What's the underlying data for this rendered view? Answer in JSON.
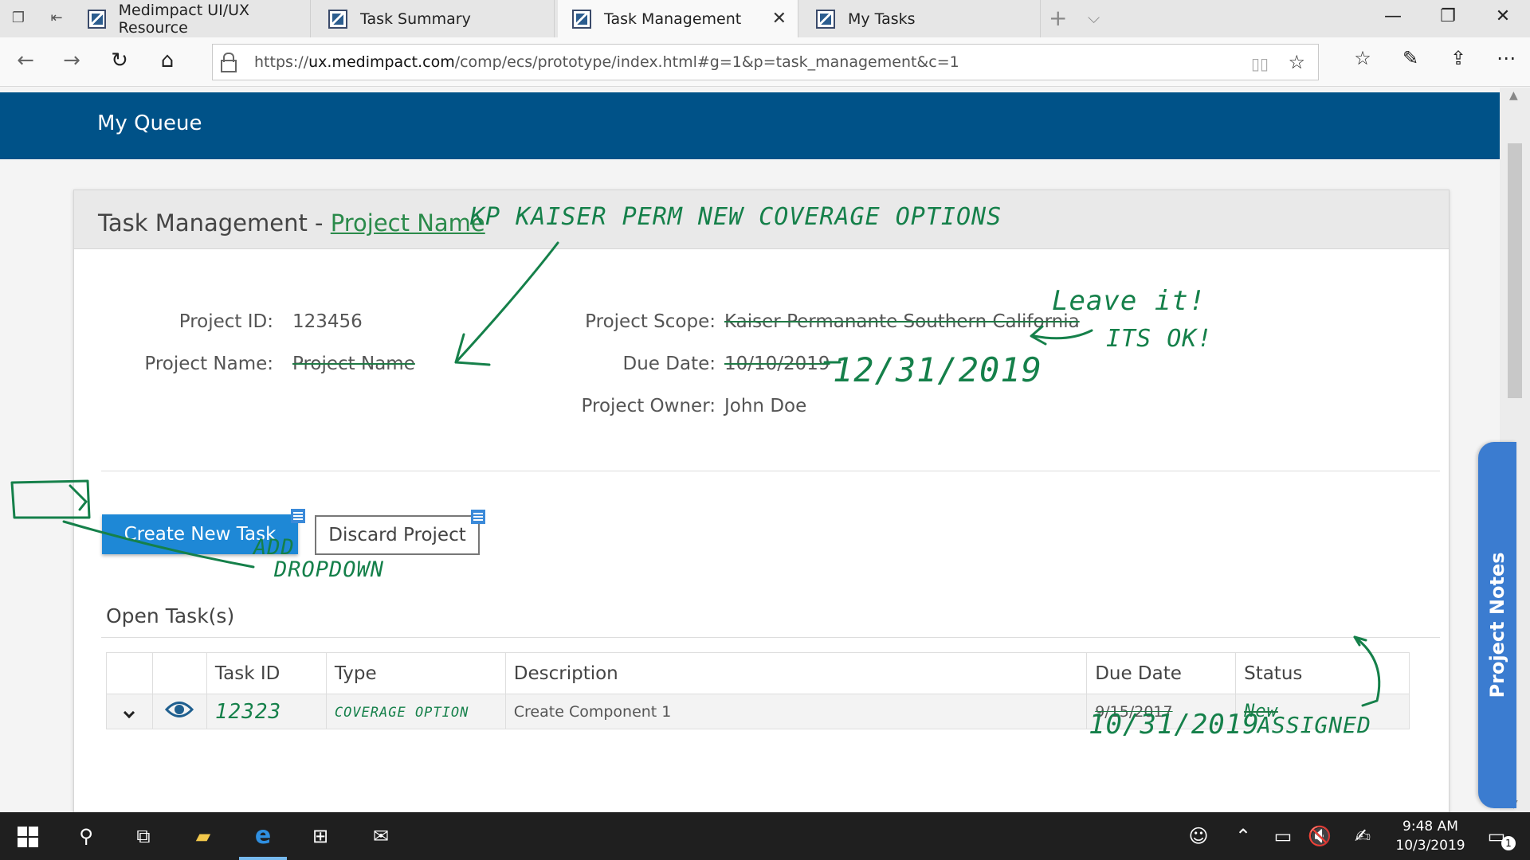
{
  "browser": {
    "tabs": [
      {
        "label": "Medimpact UI/UX Resource"
      },
      {
        "label": "Task Summary"
      },
      {
        "label": "Task Management"
      },
      {
        "label": "My Tasks"
      }
    ],
    "url_prefix": "https://",
    "url_host": "ux.medimpact.com",
    "url_path": "/comp/ecs/prototype/index.html#g=1&p=task_management&c=1"
  },
  "header": {
    "title": "My Queue"
  },
  "card": {
    "title_prefix": "Task Management - ",
    "title_project": "Project Name",
    "fields": {
      "project_id_label": "Project ID:",
      "project_id_value": "123456",
      "project_name_label": "Project Name:",
      "project_name_value": "Project Name",
      "project_scope_label": "Project Scope:",
      "project_scope_value": "Kaiser Permanante Southern California",
      "due_date_label": "Due Date:",
      "due_date_value": "10/10/2019",
      "project_owner_label": "Project Owner:",
      "project_owner_value": "John Doe"
    },
    "buttons": {
      "create": "Create New Task",
      "discard": "Discard Project"
    },
    "open_tasks_title": "Open Task(s)",
    "table": {
      "headers": [
        "",
        "",
        "Task ID",
        "Type",
        "Description",
        "Due Date",
        "Status"
      ],
      "rows": [
        {
          "task_id": "12323",
          "type": "COVERAGE OPTION",
          "description": "Create Component 1",
          "due_date": "9/15/2017",
          "status": "New"
        }
      ]
    }
  },
  "annotations": {
    "project_title": "KP KAISER PERM NEW COVERAGE OPTIONS",
    "due_date_new": "12/31/2019",
    "leave_it": "Leave it!",
    "its_ok": "ITS OK!",
    "add_dropdown_1": "ADD",
    "add_dropdown_2": "DROPDOWN",
    "task_due_new": "10/31/2019",
    "status_new": "ASSIGNED"
  },
  "side_tab": {
    "label": "Project Notes"
  },
  "taskbar": {
    "time": "9:48 AM",
    "date": "10/3/2019",
    "notification_count": "1"
  },
  "colors": {
    "header_blue": "#005288",
    "primary_button": "#1e88d6",
    "annotation_green": "#15804a",
    "notes_tab": "#3b7cd0"
  }
}
